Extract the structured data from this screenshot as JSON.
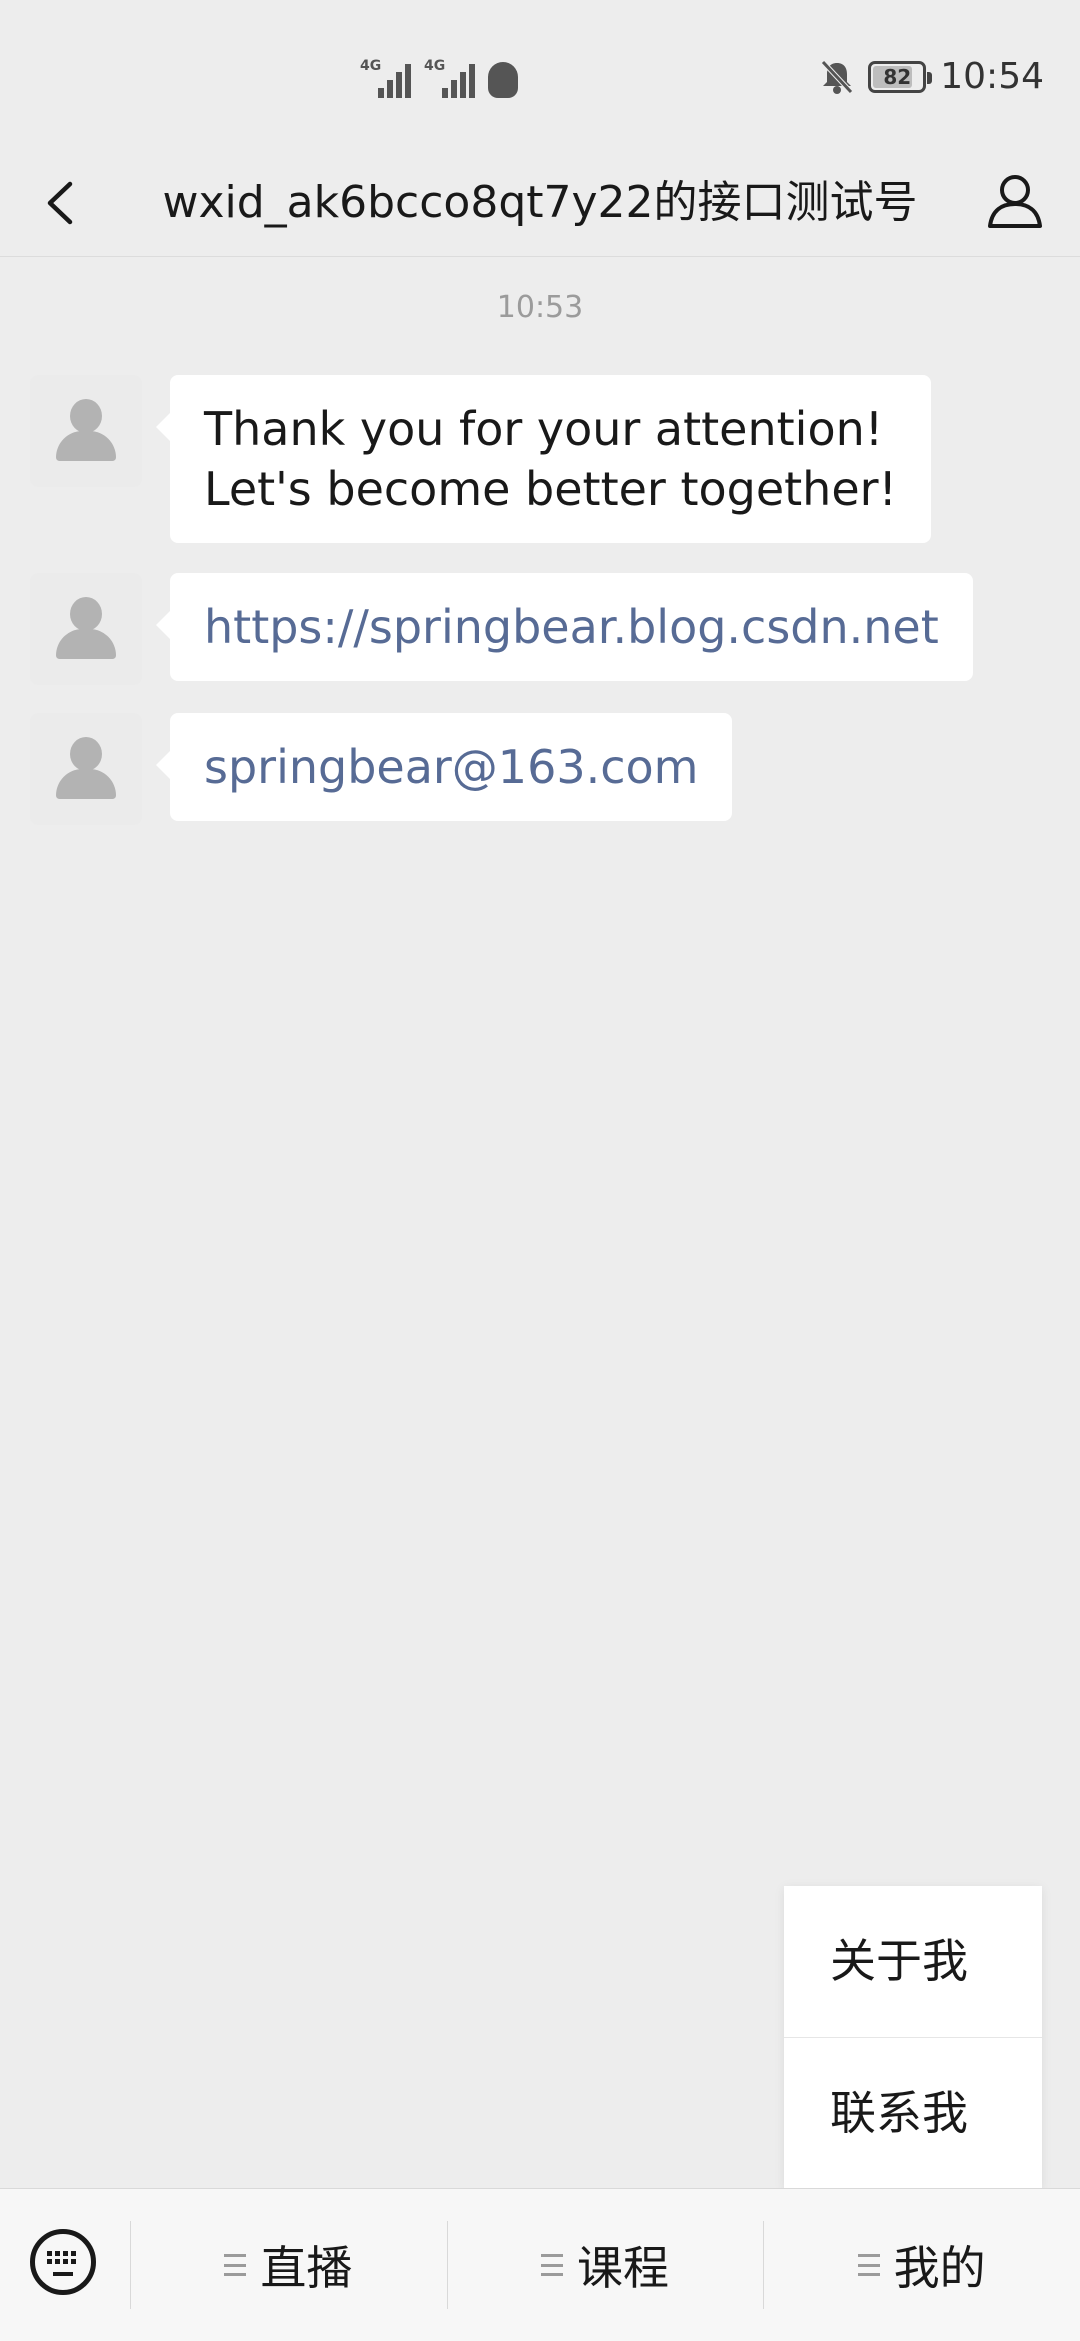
{
  "status_bar": {
    "network_1": "4G",
    "network_2": "4G",
    "battery_level": 82,
    "battery_text": "82",
    "time": "10:54",
    "icons": [
      "signal-icon",
      "signal-icon",
      "qq-icon",
      "bell-off-icon",
      "battery-icon"
    ]
  },
  "nav": {
    "title": "wxid_ak6bcco8qt7y22的接口测试号",
    "back_icon": "chevron-left-icon",
    "profile_icon": "person-icon"
  },
  "chat": {
    "timestamp": "10:53",
    "messages": [
      {
        "line1": "Thank you for your attention!",
        "line2": "Let's become better together!"
      },
      {
        "text": "https://springbear.blog.csdn.net"
      },
      {
        "text": "springbear@163.com"
      }
    ]
  },
  "popup_menu": {
    "items": [
      "关于我",
      "联系我"
    ]
  },
  "bottom_menu": {
    "keyboard_icon": "keyboard-icon",
    "items": [
      "直播",
      "课程",
      "我的"
    ]
  },
  "colors": {
    "background": "#ededed",
    "link": "#576b95",
    "bubble": "#ffffff"
  }
}
